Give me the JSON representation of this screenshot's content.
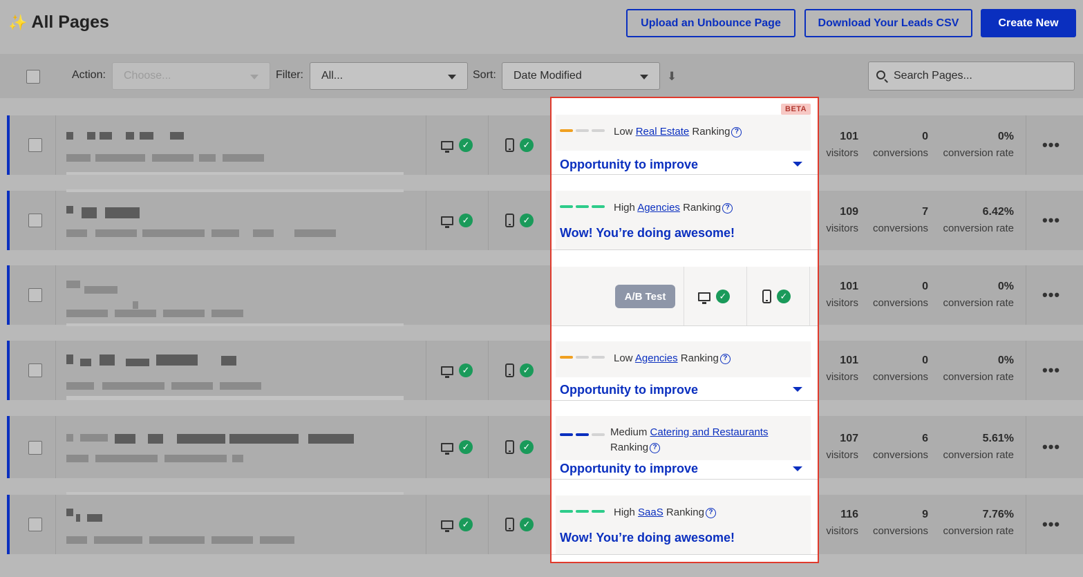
{
  "header": {
    "title": "All Pages",
    "upload_label": "Upload an Unbounce Page",
    "download_label": "Download Your Leads CSV",
    "create_label": "Create New"
  },
  "toolbar": {
    "action_label": "Action:",
    "action_placeholder": "Choose...",
    "filter_label": "Filter:",
    "filter_value": "All...",
    "sort_label": "Sort:",
    "sort_value": "Date Modified",
    "search_placeholder": "Search Pages..."
  },
  "panel": {
    "beta_label": "BETA",
    "ab_test_label": "A/B Test"
  },
  "rows": [
    {
      "level": "Low",
      "category": "Real Estate",
      "ranking_word": "Ranking",
      "message": "Opportunity to improve",
      "visitors": "101",
      "conversions": "0",
      "rate": "0%",
      "visitors_label": "visitors",
      "conversions_label": "conversions",
      "rate_label": "conversion rate"
    },
    {
      "level": "High",
      "category": "Agencies",
      "ranking_word": "Ranking",
      "message": "Wow! You’re doing awesome!",
      "visitors": "109",
      "conversions": "7",
      "rate": "6.42%",
      "visitors_label": "visitors",
      "conversions_label": "conversions",
      "rate_label": "conversion rate"
    },
    {
      "visitors": "101",
      "conversions": "0",
      "rate": "0%",
      "visitors_label": "visitors",
      "conversions_label": "conversions",
      "rate_label": "conversion rate"
    },
    {
      "level": "Low",
      "category": "Agencies",
      "ranking_word": "Ranking",
      "message": "Opportunity to improve",
      "visitors": "101",
      "conversions": "0",
      "rate": "0%",
      "visitors_label": "visitors",
      "conversions_label": "conversions",
      "rate_label": "conversion rate"
    },
    {
      "level": "Medium",
      "category": "Catering and Restaurants",
      "ranking_word": "Ranking",
      "message": "Opportunity to improve",
      "visitors": "107",
      "conversions": "6",
      "rate": "5.61%",
      "visitors_label": "visitors",
      "conversions_label": "conversions",
      "rate_label": "conversion rate"
    },
    {
      "level": "High",
      "category": "SaaS",
      "ranking_word": "Ranking",
      "message": "Wow! You’re doing awesome!",
      "visitors": "116",
      "conversions": "9",
      "rate": "7.76%",
      "visitors_label": "visitors",
      "conversions_label": "conversions",
      "rate_label": "conversion rate"
    }
  ],
  "colors": {
    "accent": "#0a2fbf",
    "low": "#f0a020",
    "high": "#2ecc8a",
    "medium": "#0a2fbf",
    "inactive_bar": "#d3d3d3",
    "highlight_border": "#e03a2c",
    "beta_bg": "#f7c8c4"
  }
}
